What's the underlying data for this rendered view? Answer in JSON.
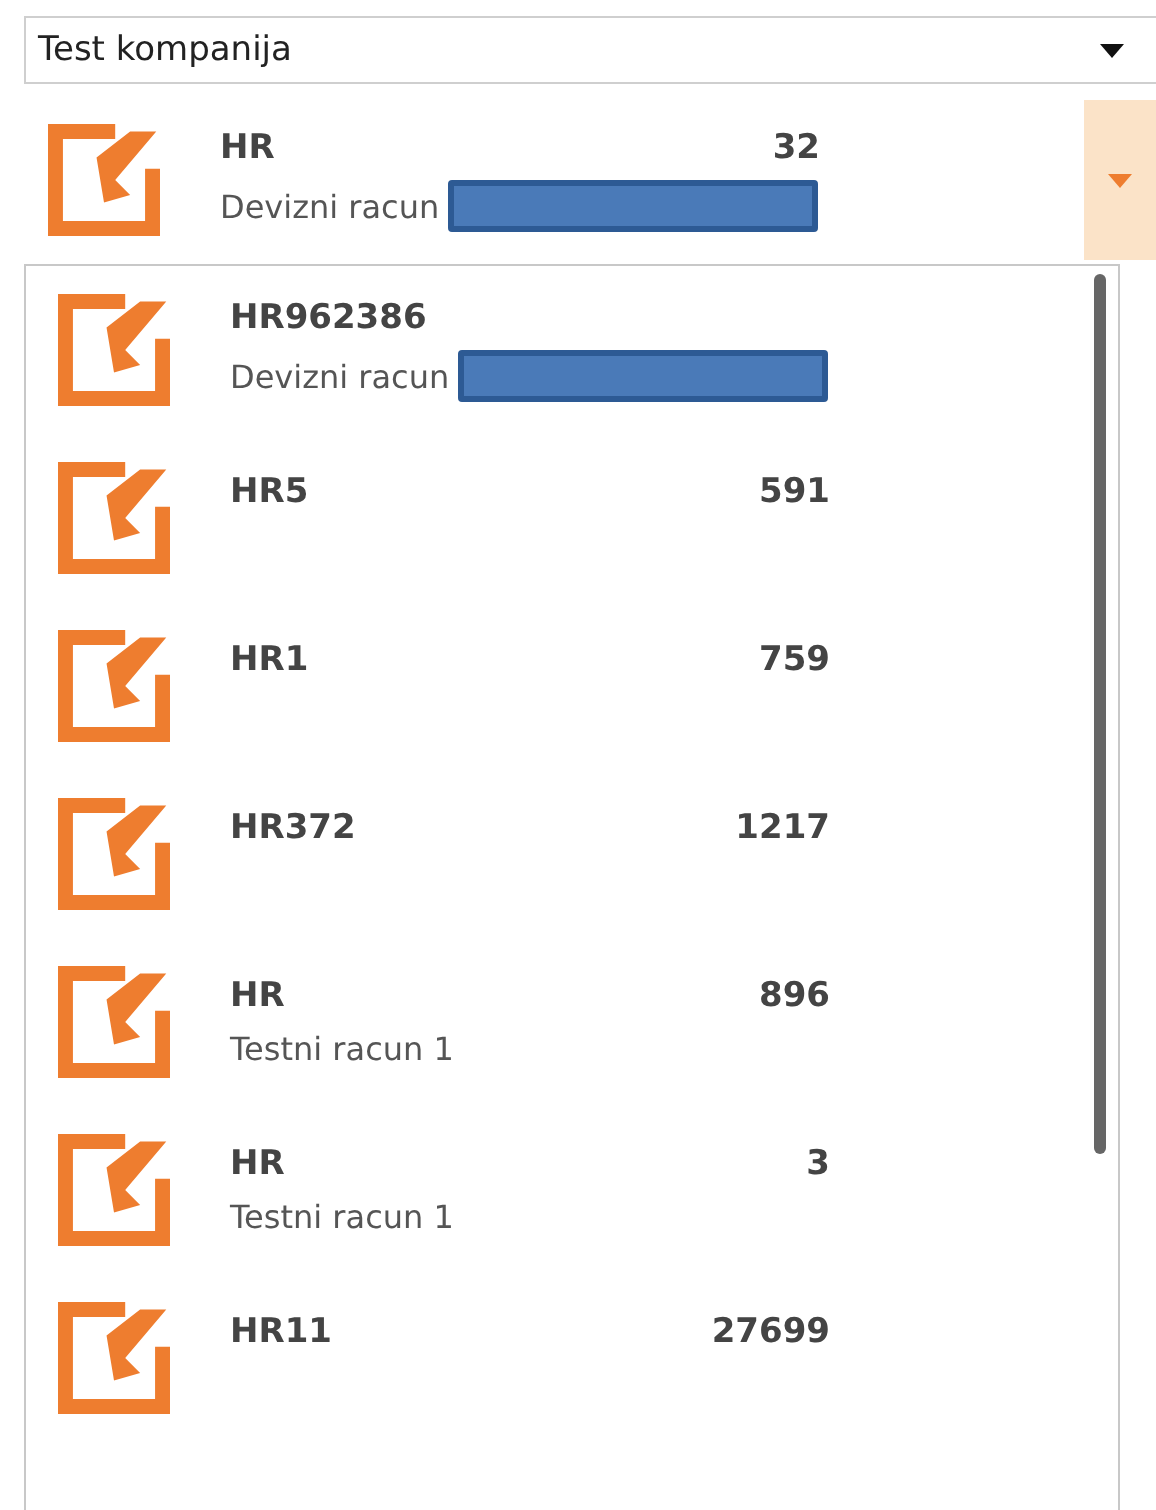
{
  "company_select": {
    "value": "Test kompanija"
  },
  "selected_account": {
    "number_start": "HR",
    "number_end": "32",
    "description": "Devizni racun",
    "redacted": true
  },
  "accounts": [
    {
      "number_start": "HR962386",
      "description": "Devizni racun",
      "redacted": true
    },
    {
      "number_start": "HR5",
      "number_end": "591",
      "redacted": false
    },
    {
      "number_start": "HR1",
      "number_end": "759",
      "redacted": false
    },
    {
      "number_start": "HR372",
      "number_end": "1217",
      "redacted": false
    },
    {
      "number_start": "HR",
      "number_end": "896",
      "description": "Testni racun 1",
      "redacted": false
    },
    {
      "number_start": "HR",
      "number_end": "3",
      "description": "Testni racun 1",
      "redacted": false
    },
    {
      "number_start": "HR11",
      "number_end": "27699",
      "redacted": false
    }
  ]
}
